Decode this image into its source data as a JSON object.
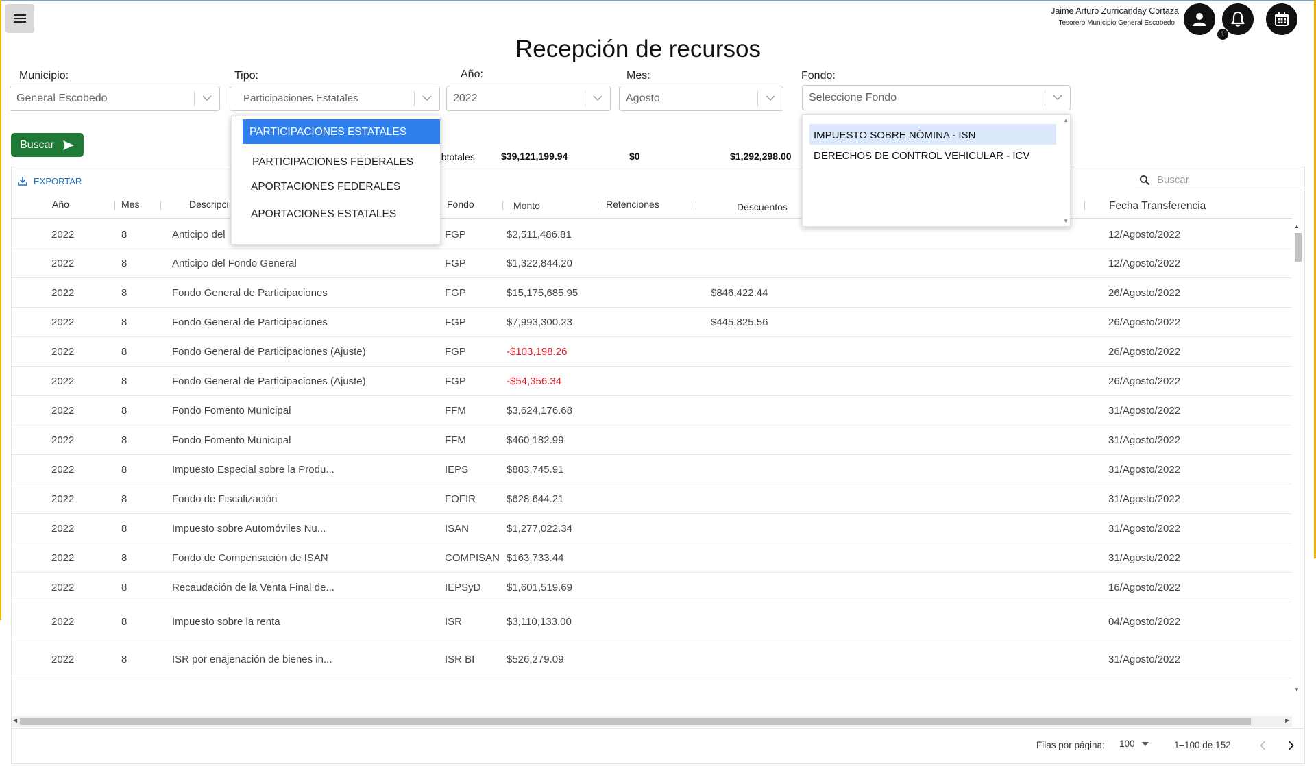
{
  "header": {
    "user_name": "Jaime Arturo Zurricanday Cortaza",
    "user_role": "Tesorero Municipio General Escobedo",
    "notification_count": "1",
    "title": "Recepción de recursos"
  },
  "filters": {
    "municipio": {
      "label": "Municipio:",
      "value": "General Escobedo"
    },
    "tipo": {
      "label": "Tipo:",
      "value": "Participaciones Estatales",
      "options": [
        "PARTICIPACIONES ESTATALES",
        "PARTICIPACIONES FEDERALES",
        "APORTACIONES FEDERALES",
        "APORTACIONES ESTATALES"
      ],
      "selected_option": "PARTICIPACIONES ESTATALES"
    },
    "anio": {
      "label": "Año:",
      "value": "2022"
    },
    "mes": {
      "label": "Mes:",
      "value": "Agosto"
    },
    "fondo": {
      "label": "Fondo:",
      "placeholder": "Seleccione Fondo",
      "options": [
        "IMPUESTO SOBRE NÓMINA - ISN",
        "DERECHOS DE CONTROL VEHICULAR - ICV"
      ],
      "highlighted_option": "IMPUESTO SOBRE NÓMINA - ISN"
    }
  },
  "buscar_label": "Buscar",
  "subtotals": {
    "label": "ubtotales",
    "monto": "$39,121,199.94",
    "retenciones": "$0",
    "descuentos": "$1,292,298.00"
  },
  "toolbar": {
    "export_label": "EXPORTAR",
    "search_placeholder": "Buscar"
  },
  "table": {
    "columns": [
      "Año",
      "Mes",
      "Descripci",
      "Fondo",
      "Monto",
      "Retenciones",
      "Descuentos",
      "Fecha Transferencia"
    ],
    "rows": [
      {
        "anio": "2022",
        "mes": "8",
        "descripcion": "Anticipo del",
        "fondo": "FGP",
        "monto": "$2,511,486.81",
        "descuentos": "",
        "fecha": "12/Agosto/2022"
      },
      {
        "anio": "2022",
        "mes": "8",
        "descripcion": "Anticipo del Fondo General",
        "fondo": "FGP",
        "monto": "$1,322,844.20",
        "descuentos": "",
        "fecha": "12/Agosto/2022"
      },
      {
        "anio": "2022",
        "mes": "8",
        "descripcion": "Fondo General de Participaciones",
        "fondo": "FGP",
        "monto": "$15,175,685.95",
        "descuentos": "$846,422.44",
        "fecha": "26/Agosto/2022"
      },
      {
        "anio": "2022",
        "mes": "8",
        "descripcion": "Fondo General de Participaciones",
        "fondo": "FGP",
        "monto": "$7,993,300.23",
        "descuentos": "$445,825.56",
        "fecha": "26/Agosto/2022"
      },
      {
        "anio": "2022",
        "mes": "8",
        "descripcion": "Fondo General de Participaciones (Ajuste)",
        "fondo": "FGP",
        "monto": "-$103,198.26",
        "descuentos": "",
        "fecha": "26/Agosto/2022",
        "negative": true
      },
      {
        "anio": "2022",
        "mes": "8",
        "descripcion": "Fondo General de Participaciones (Ajuste)",
        "fondo": "FGP",
        "monto": "-$54,356.34",
        "descuentos": "",
        "fecha": "26/Agosto/2022",
        "negative": true
      },
      {
        "anio": "2022",
        "mes": "8",
        "descripcion": "Fondo Fomento Municipal",
        "fondo": "FFM",
        "monto": "$3,624,176.68",
        "descuentos": "",
        "fecha": "31/Agosto/2022"
      },
      {
        "anio": "2022",
        "mes": "8",
        "descripcion": "Fondo Fomento Municipal",
        "fondo": "FFM",
        "monto": "$460,182.99",
        "descuentos": "",
        "fecha": "31/Agosto/2022"
      },
      {
        "anio": "2022",
        "mes": "8",
        "descripcion": "Impuesto Especial sobre la Produ...",
        "fondo": "IEPS",
        "monto": "$883,745.91",
        "descuentos": "",
        "fecha": "31/Agosto/2022"
      },
      {
        "anio": "2022",
        "mes": "8",
        "descripcion": "Fondo de Fiscalización",
        "fondo": "FOFIR",
        "monto": "$628,644.21",
        "descuentos": "",
        "fecha": "31/Agosto/2022"
      },
      {
        "anio": "2022",
        "mes": "8",
        "descripcion": "Impuesto sobre Automóviles Nu...",
        "fondo": "ISAN",
        "monto": "$1,277,022.34",
        "descuentos": "",
        "fecha": "31/Agosto/2022"
      },
      {
        "anio": "2022",
        "mes": "8",
        "descripcion": "Fondo de Compensación de ISAN",
        "fondo": "COMPISAN",
        "monto": "$163,733.44",
        "descuentos": "",
        "fecha": "31/Agosto/2022"
      },
      {
        "anio": "2022",
        "mes": "8",
        "descripcion": "Recaudación de la Venta Final de...",
        "fondo": "IEPSyD",
        "monto": "$1,601,519.69",
        "descuentos": "",
        "fecha": "16/Agosto/2022"
      },
      {
        "anio": "2022",
        "mes": "8",
        "descripcion": "Impuesto sobre la renta",
        "fondo": "ISR",
        "monto": "$3,110,133.00",
        "descuentos": "",
        "fecha": "04/Agosto/2022"
      },
      {
        "anio": "2022",
        "mes": "8",
        "descripcion": "ISR por enajenación de bienes in...",
        "fondo": "ISR BI",
        "monto": "$526,279.09",
        "descuentos": "",
        "fecha": "31/Agosto/2022"
      }
    ]
  },
  "pagination": {
    "rows_per_page_label": "Filas por página:",
    "rows_per_page": "100",
    "range": "1–100 de 152"
  },
  "colors": {
    "primary_green": "#1f7a36",
    "accent_blue": "#2f80ed",
    "negative_red": "#e0202a",
    "link_blue": "#1f6fc4"
  }
}
